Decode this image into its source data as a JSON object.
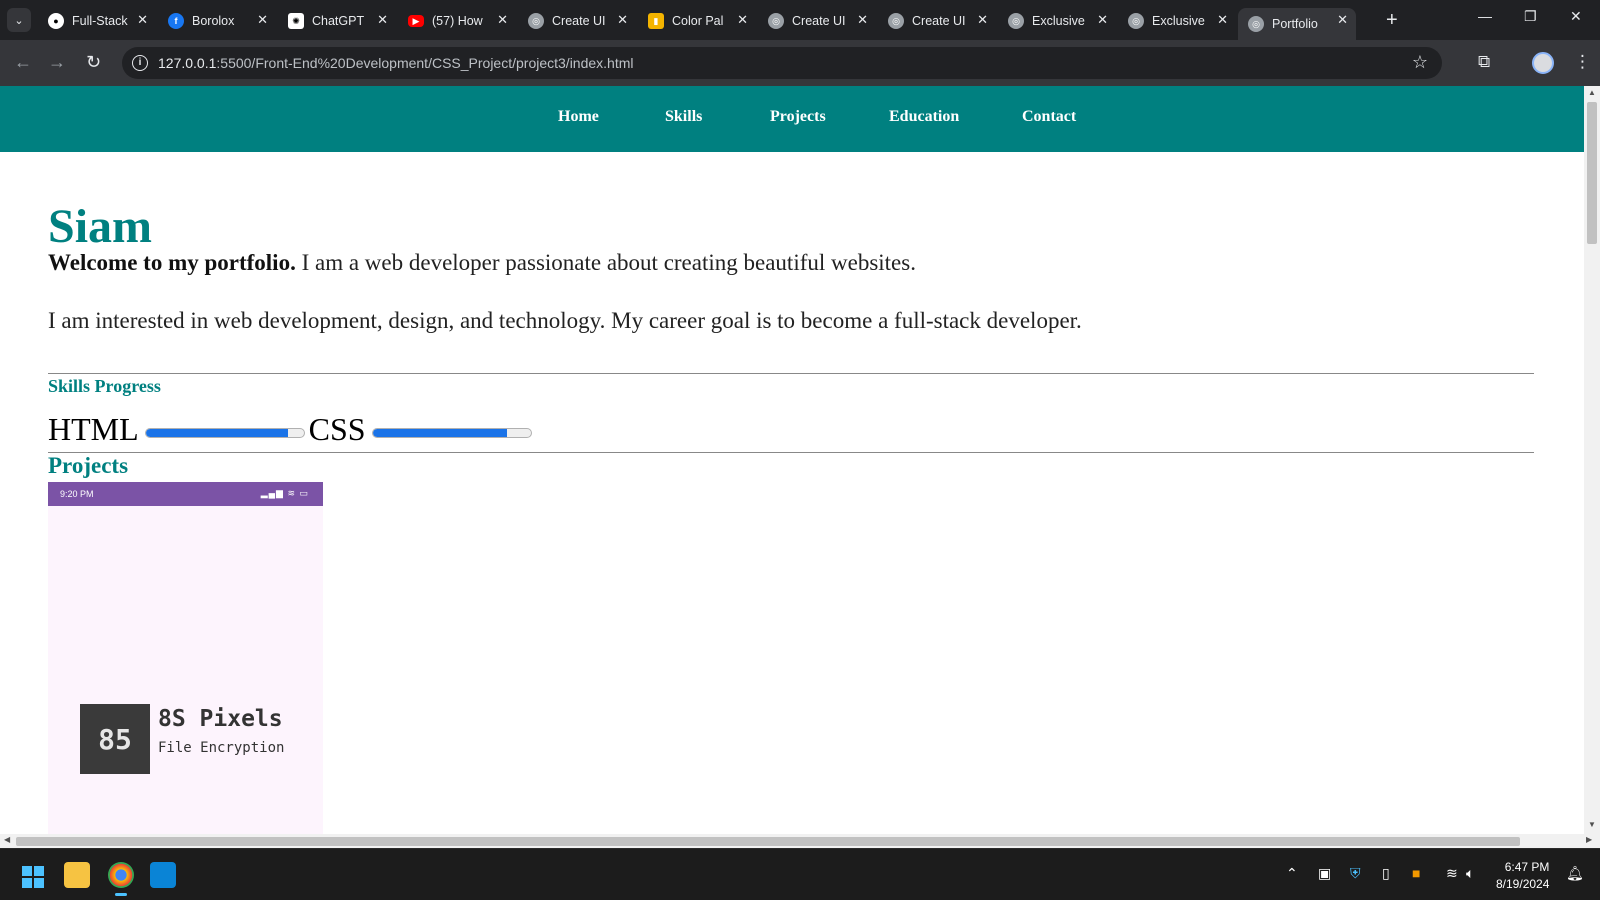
{
  "browser": {
    "tabs": [
      {
        "title": "Full-Stack",
        "favicon": "github-icon"
      },
      {
        "title": "Borolox",
        "favicon": "facebook-icon"
      },
      {
        "title": "ChatGPT",
        "favicon": "chatgpt-icon"
      },
      {
        "title": "(57) How",
        "favicon": "youtube-icon"
      },
      {
        "title": "Create UI",
        "favicon": "globe-icon"
      },
      {
        "title": "Color Pal",
        "favicon": "palette-icon"
      },
      {
        "title": "Create UI",
        "favicon": "globe-icon"
      },
      {
        "title": "Create UI",
        "favicon": "globe-icon"
      },
      {
        "title": "Exclusive",
        "favicon": "globe-icon"
      },
      {
        "title": "Exclusive",
        "favicon": "globe-icon"
      },
      {
        "title": "Portfolio",
        "favicon": "globe-icon",
        "active": true
      }
    ],
    "url_host": "127.0.0.1",
    "url_path": ":5500/Front-End%20Development/CSS_Project/project3/index.html"
  },
  "site": {
    "nav": [
      "Home",
      "Skills",
      "Projects",
      "Education",
      "Contact"
    ],
    "name": "Siam",
    "intro_bold": "Welcome to my portfolio.",
    "intro_rest": " I am a web developer passionate about creating beautiful websites.",
    "about": "I am interested in web development, design, and technology. My career goal is to become a full-stack developer.",
    "skills_title": "Skills Progress",
    "skills": [
      {
        "label": "HTML",
        "progress": 0.9
      },
      {
        "label": "CSS",
        "progress": 0.85
      }
    ],
    "projects_title": "Projects",
    "project_card": {
      "status_time": "9:20 PM",
      "logo_text": "85",
      "brand": "8S Pixels",
      "tagline": "File Encryption"
    }
  },
  "taskbar": {
    "time": "6:47 PM",
    "date": "8/19/2024"
  },
  "colors": {
    "accent": "#008080",
    "progress": "#1a73e8"
  }
}
